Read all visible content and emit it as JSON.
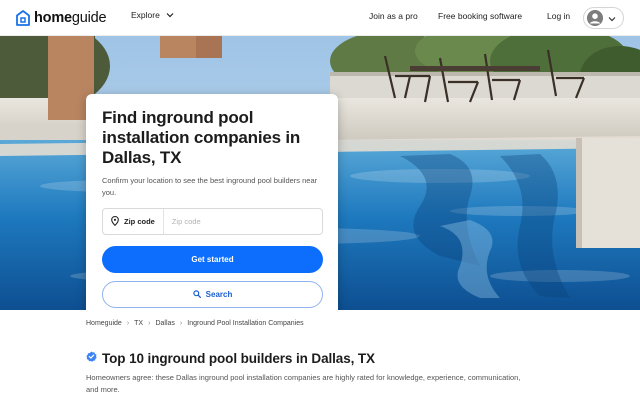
{
  "header": {
    "logo_bold": "home",
    "logo_light": "guide",
    "explore_label": "Explore",
    "links": [
      "Join as a pro",
      "Free booking software",
      "Log in"
    ]
  },
  "card": {
    "title": "Find inground pool installation companies in Dallas, TX",
    "subtitle": "Confirm your location to see the best inground pool builders near you.",
    "zip_label": "Zip code",
    "zip_placeholder": "Zip code",
    "zip_value": "",
    "primary_button": "Get started",
    "secondary_button": "Search"
  },
  "breadcrumb": [
    "Homeguide",
    "TX",
    "Dallas",
    "Inground Pool Installation Companies"
  ],
  "section": {
    "title": "Top 10 inground pool builders in Dallas, TX",
    "description": "Homeowners agree: these Dallas inground pool installation companies are highly rated for knowledge, experience, communication, and more."
  },
  "icons": {
    "logo": "house-logo-icon",
    "explore_chevron": "chevron-down-icon",
    "avatar": "user-avatar-icon",
    "avatar_chevron": "chevron-down-icon",
    "zip": "location-pin-icon",
    "search": "search-icon",
    "verified": "verified-badge-icon"
  },
  "colors": {
    "primary": "#0d6efd",
    "logo": "#1a73e8",
    "verified": "#3b82f6"
  }
}
